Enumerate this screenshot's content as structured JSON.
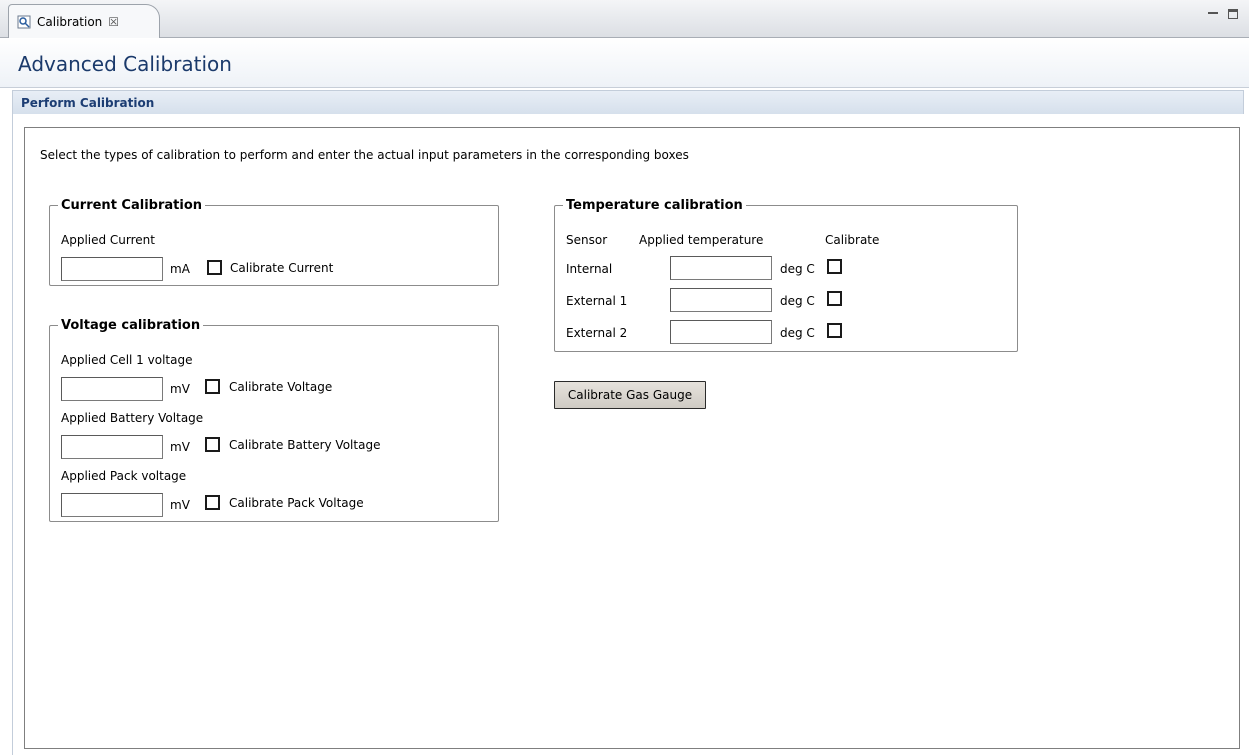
{
  "tab": {
    "label": "Calibration",
    "close_glyph": "☒",
    "icon": "calibration-tab-icon"
  },
  "window_controls": {
    "minimize": "minimize-icon",
    "maximize": "maximize-icon"
  },
  "header": {
    "title": "Advanced Calibration"
  },
  "section": {
    "title": "Perform Calibration"
  },
  "instruction": "Select the types of calibration to perform and enter the actual input parameters in the corresponding boxes",
  "current_calibration": {
    "legend": "Current Calibration",
    "label": "Applied Current",
    "value": "",
    "unit": "mA",
    "checkbox_label": "Calibrate Current",
    "checked": false
  },
  "voltage_calibration": {
    "legend": "Voltage calibration",
    "rows": [
      {
        "label": "Applied Cell 1 voltage",
        "value": "",
        "unit": "mV",
        "checkbox_label": "Calibrate Voltage",
        "checked": false
      },
      {
        "label": "Applied Battery Voltage",
        "value": "",
        "unit": "mV",
        "checkbox_label": "Calibrate Battery Voltage",
        "checked": false
      },
      {
        "label": "Applied Pack voltage",
        "value": "",
        "unit": "mV",
        "checkbox_label": "Calibrate Pack Voltage",
        "checked": false
      }
    ]
  },
  "temperature_calibration": {
    "legend": "Temperature calibration",
    "headers": {
      "sensor": "Sensor",
      "applied": "Applied temperature",
      "calibrate": "Calibrate"
    },
    "rows": [
      {
        "sensor": "Internal",
        "value": "",
        "unit": "deg C",
        "checked": false
      },
      {
        "sensor": "External 1",
        "value": "",
        "unit": "deg C",
        "checked": false
      },
      {
        "sensor": "External 2",
        "value": "",
        "unit": "deg C",
        "checked": false
      }
    ]
  },
  "calibrate_button": {
    "label": "Calibrate Gas Gauge"
  }
}
